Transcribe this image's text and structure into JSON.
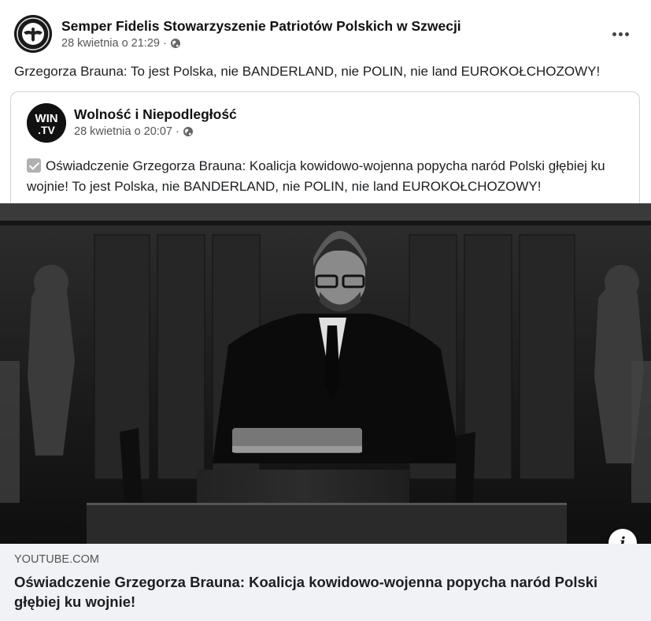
{
  "post": {
    "page_name": "Semper Fidelis Stowarzyszenie Patriotów Polskich w Szwecji",
    "timestamp": "28 kwietnia o 21:29",
    "separator": "·",
    "audience_icon": "globe-icon",
    "text": "Grzegorza Brauna: To jest Polska, nie BANDERLAND, nie POLIN, nie land EUROKOŁCHOZOWY!",
    "more_icon": "more-options-icon"
  },
  "shared": {
    "page_name": "Wolność i Niepodległość",
    "avatar_text_top": "WIN",
    "avatar_text_bottom": ".TV",
    "timestamp": "28 kwietnia o 20:07",
    "separator": "·",
    "audience_icon": "globe-icon",
    "check_icon": "checkmark-box-icon",
    "text": "Oświadczenie Grzegorza Brauna: Koalicja kowidowo-wojenna popycha naród Polski głębiej ku wojnie! To jest Polska, nie BANDERLAND, nie POLIN, nie land EUROKOŁCHOZOWY!"
  },
  "link": {
    "domain": "YOUTUBE.COM",
    "title": "Oświadczenie Grzegorza Brauna: Koalicja kowidowo-wojenna popycha naród Polski głębiej ku wojnie!",
    "info_label": "i"
  },
  "colors": {
    "card": "#ffffff",
    "footer": "#f0f2f5",
    "text": "#1c1e21",
    "meta": "#555555"
  }
}
